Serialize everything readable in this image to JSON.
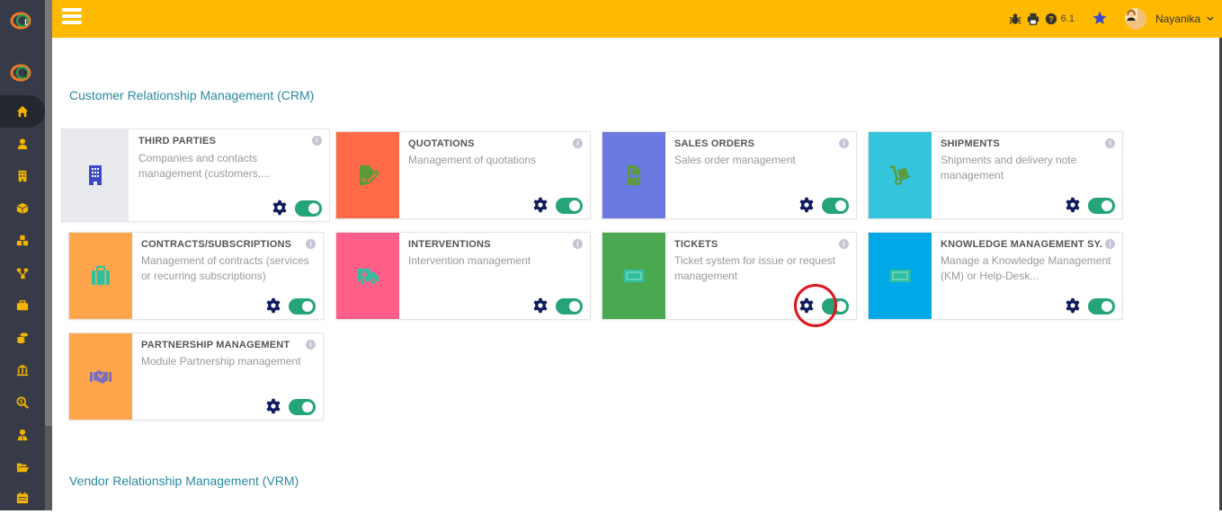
{
  "topbar": {
    "menu_icon": "hamburger-icon",
    "version": "6.1",
    "username": "Nayanika",
    "icons": [
      "bug-icon",
      "printer-icon",
      "help-icon",
      "star-icon"
    ]
  },
  "sidebar": {
    "items": [
      {
        "name": "home",
        "icon": "home-icon",
        "active": true
      },
      {
        "name": "users",
        "icon": "user-icon"
      },
      {
        "name": "companies",
        "icon": "building-icon"
      },
      {
        "name": "products",
        "icon": "box-icon"
      },
      {
        "name": "modules",
        "icon": "cubes-icon"
      },
      {
        "name": "projects",
        "icon": "sitemap-icon"
      },
      {
        "name": "commerce",
        "icon": "briefcase-icon"
      },
      {
        "name": "billing",
        "icon": "coins-icon"
      },
      {
        "name": "bank",
        "icon": "bank-icon"
      },
      {
        "name": "accounting",
        "icon": "search-dollar-icon"
      },
      {
        "name": "hrm",
        "icon": "user-tie-icon"
      },
      {
        "name": "documents",
        "icon": "folder-open-icon"
      },
      {
        "name": "agenda",
        "icon": "calendar-icon"
      }
    ]
  },
  "sections": {
    "crm": {
      "title": "Customer Relationship Management (CRM)"
    },
    "vrm": {
      "title": "Vendor Relationship Management (VRM)"
    }
  },
  "modules": [
    {
      "title": "THIRD PARTIES",
      "desc": "Companies and contacts management (customers,...",
      "color": "#e9eaed",
      "icon": "building-icon",
      "icon_color": "#3b4bc8",
      "enabled": true
    },
    {
      "title": "QUOTATIONS",
      "desc": "Management of quotations",
      "color": "#ff6a48",
      "icon": "file-signature-icon",
      "icon_color": "#5a9a3a",
      "enabled": true
    },
    {
      "title": "SALES ORDERS",
      "desc": "Sales order management",
      "color": "#6b7ae0",
      "icon": "file-invoice-icon",
      "icon_color": "#5a9a3a",
      "enabled": true
    },
    {
      "title": "SHIPMENTS",
      "desc": "Shipments and delivery note management",
      "color": "#35c5da",
      "icon": "dolly-icon",
      "icon_color": "#5a9a3a",
      "enabled": true
    },
    {
      "title": "CONTRACTS/SUBSCRIPTIONS",
      "desc": "Management of contracts (services or recurring subscriptions)",
      "color": "#ffa64d",
      "icon": "suitcase-icon",
      "icon_color": "#2fbfa0",
      "enabled": true
    },
    {
      "title": "INTERVENTIONS",
      "desc": "Intervention management",
      "color": "#ff5f88",
      "icon": "ambulance-icon",
      "icon_color": "#2fbfa0",
      "enabled": true
    },
    {
      "title": "TICKETS",
      "desc": "Ticket system for issue or request management",
      "color": "#4aa851",
      "icon": "ticket-icon",
      "icon_color": "#2fbfa0",
      "enabled": true,
      "highlighted": true
    },
    {
      "title": "KNOWLEDGE MANAGEMENT SY...",
      "desc": "Manage a Knowledge Management (KM) or Help-Desk...",
      "color": "#00a8e8",
      "icon": "ticket-icon",
      "icon_color": "#2fbfa0",
      "enabled": true
    },
    {
      "title": "PARTNERSHIP MANAGEMENT",
      "desc": "Module Partnership management",
      "color": "#ffa64d",
      "icon": "handshake-icon",
      "icon_color": "#7a6fbf",
      "enabled": true
    }
  ],
  "info_glyph": "i"
}
